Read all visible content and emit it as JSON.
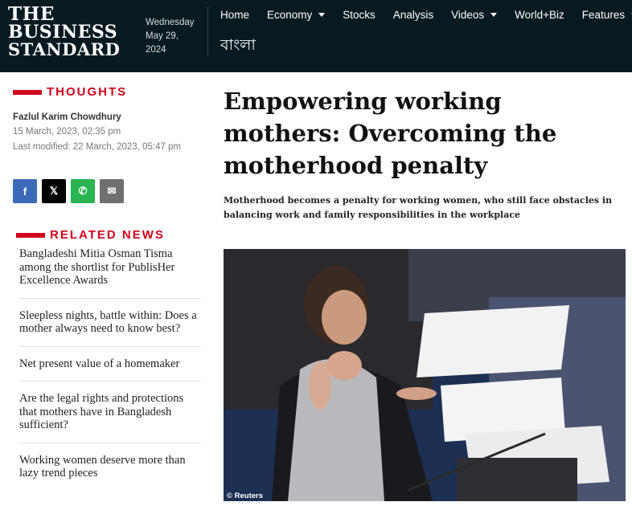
{
  "header": {
    "logo": [
      "THE",
      "BUSINESS",
      "STANDARD"
    ],
    "date": [
      "Wednesday",
      "May 29,",
      "2024"
    ],
    "nav": [
      "Home",
      "Economy",
      "Stocks",
      "Analysis",
      "Videos",
      "World+Biz",
      "Features"
    ],
    "bangla": "বাংলা"
  },
  "section": "THOUGHTS",
  "article": {
    "author": "Fazlul Karim Chowdhury",
    "published": "15 March, 2023, 02:35 pm",
    "modified": "Last modified: 22 March, 2023, 05:47 pm",
    "headline": "Empowering working mothers: Overcoming the motherhood penalty",
    "standfirst": "Motherhood becomes a penalty for working women, who still face obstacles in balancing work and family responsibilities in the workplace",
    "photo_credit": "© Reuters"
  },
  "share": {
    "facebook": "f",
    "x": "𝕏",
    "whatsapp": "✆",
    "email": "✉"
  },
  "related": {
    "title": "RELATED NEWS",
    "items": [
      "Bangladeshi Mitia Osman Tisma among the shortlist for PublisHer Excellence Awards",
      "Sleepless nights, battle within: Does a mother always need to know best?",
      "Net present value of a homemaker",
      "Are the legal rights and protections that mothers have in Bangladesh sufficient?",
      "Working women deserve more than lazy trend pieces"
    ]
  },
  "icons": {
    "dropdown": "chevron-down-icon",
    "facebook": "facebook-icon",
    "x": "x-icon",
    "whatsapp": "whatsapp-icon",
    "email": "email-icon"
  },
  "colors": {
    "header_bg": "#071a21",
    "accent": "#d0021b",
    "facebook": "#3b6bb8",
    "whatsapp": "#2ab452"
  }
}
